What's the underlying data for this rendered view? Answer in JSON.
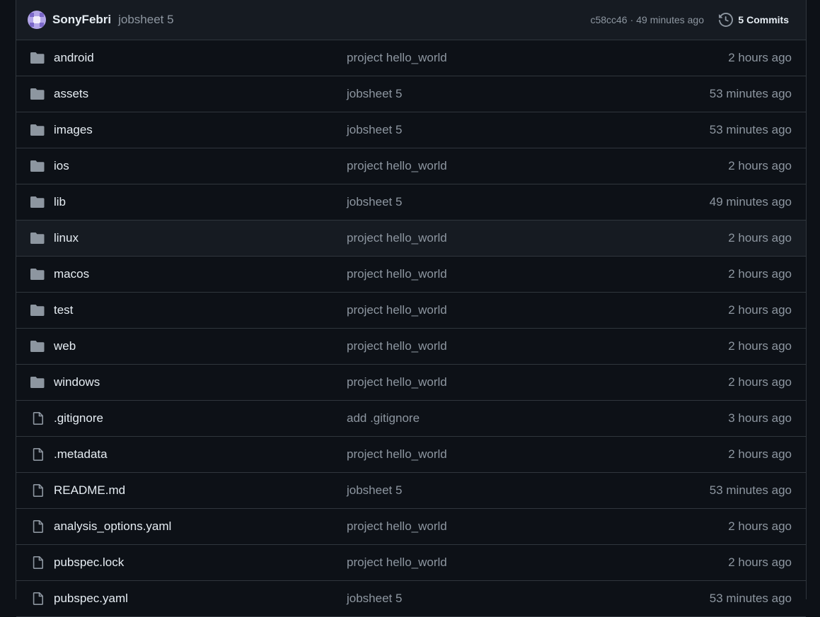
{
  "latest_commit": {
    "author": "SonyFebri",
    "message": "jobsheet 5",
    "hash": "c58cc46",
    "separator": "·",
    "time": "49 minutes ago",
    "commits_label": "5 Commits"
  },
  "files": [
    {
      "type": "folder",
      "name": "android",
      "message": "project hello_world",
      "age": "2 hours ago"
    },
    {
      "type": "folder",
      "name": "assets",
      "message": "jobsheet 5",
      "age": "53 minutes ago"
    },
    {
      "type": "folder",
      "name": "images",
      "message": "jobsheet 5",
      "age": "53 minutes ago"
    },
    {
      "type": "folder",
      "name": "ios",
      "message": "project hello_world",
      "age": "2 hours ago"
    },
    {
      "type": "folder",
      "name": "lib",
      "message": "jobsheet 5",
      "age": "49 minutes ago"
    },
    {
      "type": "folder",
      "name": "linux",
      "message": "project hello_world",
      "age": "2 hours ago"
    },
    {
      "type": "folder",
      "name": "macos",
      "message": "project hello_world",
      "age": "2 hours ago"
    },
    {
      "type": "folder",
      "name": "test",
      "message": "project hello_world",
      "age": "2 hours ago"
    },
    {
      "type": "folder",
      "name": "web",
      "message": "project hello_world",
      "age": "2 hours ago"
    },
    {
      "type": "folder",
      "name": "windows",
      "message": "project hello_world",
      "age": "2 hours ago"
    },
    {
      "type": "file",
      "name": ".gitignore",
      "message": "add .gitignore",
      "age": "3 hours ago"
    },
    {
      "type": "file",
      "name": ".metadata",
      "message": "project hello_world",
      "age": "2 hours ago"
    },
    {
      "type": "file",
      "name": "README.md",
      "message": "jobsheet 5",
      "age": "53 minutes ago"
    },
    {
      "type": "file",
      "name": "analysis_options.yaml",
      "message": "project hello_world",
      "age": "2 hours ago"
    },
    {
      "type": "file",
      "name": "pubspec.lock",
      "message": "project hello_world",
      "age": "2 hours ago"
    },
    {
      "type": "file",
      "name": "pubspec.yaml",
      "message": "jobsheet 5",
      "age": "53 minutes ago"
    }
  ],
  "icons": {
    "folder": "folder-icon",
    "file": "file-icon",
    "history": "history-icon"
  },
  "colors": {
    "background": "#0d1117",
    "header_background": "#161b22",
    "border": "#30363d",
    "primary_text": "#e6edf3",
    "muted_text": "#8d96a0",
    "folder_icon": "#8d96a0"
  }
}
